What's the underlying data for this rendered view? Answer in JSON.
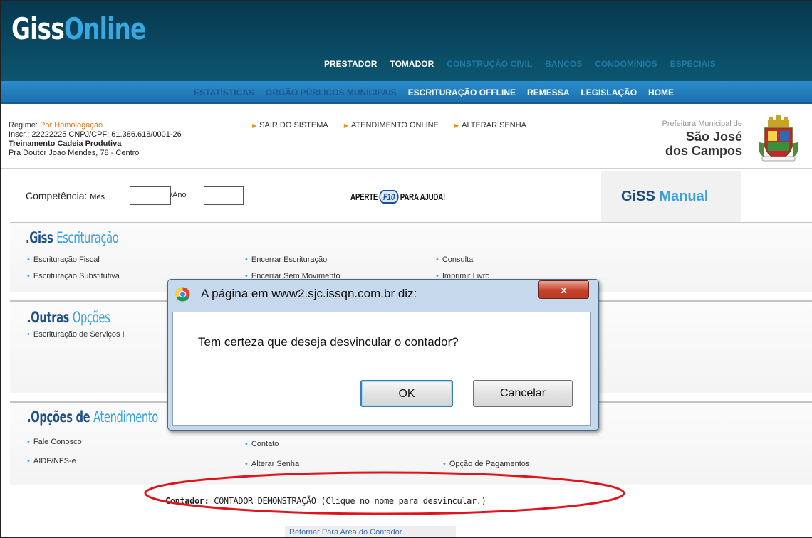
{
  "header": {
    "logo_part1": "Giss",
    "logo_part2": "Online",
    "nav_primary": [
      {
        "label": "PRESTADOR",
        "active": true
      },
      {
        "label": "TOMADOR",
        "active": true
      },
      {
        "label": "CONSTRUÇÃO CIVIL",
        "active": false
      },
      {
        "label": "BANCOS",
        "active": false
      },
      {
        "label": "CONDOMÍNIOS",
        "active": false
      },
      {
        "label": "ESPECIAIS",
        "active": false
      }
    ],
    "nav_secondary": [
      {
        "label": "ESTATÍSTICAS",
        "active": false
      },
      {
        "label": "ORGÃO PÚBLICOS MUNICIPAIS",
        "active": false
      },
      {
        "label": "ESCRITURAÇÃO OFFLINE",
        "active": true
      },
      {
        "label": "REMESSA",
        "active": true
      },
      {
        "label": "LEGISLAÇÃO",
        "active": true
      },
      {
        "label": "HOME",
        "active": true
      }
    ]
  },
  "info": {
    "regime_label": "Regime:",
    "regime_value": "Por Homologação",
    "inscr": "Inscr.: 22222225 CNPJ/CPF: 61.386.618/0001-26",
    "company": "Treinamento Cadeia Produtiva",
    "address": "Pra Doutor Joao Mendes, 78 - Centro",
    "links": [
      "SAIR DO SISTEMA",
      "ATENDIMENTO ONLINE",
      "ALTERAR SENHA"
    ],
    "prefeitura": "Prefeitura Municipal de",
    "city_line1": "São José",
    "city_line2": "dos Campos"
  },
  "competencia": {
    "label": "Competência:",
    "mes_label": "Mês",
    "mes_value": "",
    "ano_label": "/Ano",
    "ano_value": "",
    "aperte": "APERTE",
    "f10": "F10",
    "ajuda": "PARA AJUDA!",
    "manual_part1": "GiSS",
    "manual_part2": "Manual"
  },
  "sections": {
    "escrituracao": {
      "title_a": ".Giss",
      "title_b": "Escrituração",
      "items": [
        "Escrituração Fiscal",
        "Encerrar Escrituração",
        "Consulta",
        "Escrituração Substitutiva",
        "Encerrar Sem Movimento",
        "Imprimir Livro"
      ]
    },
    "outras": {
      "title_a": ".Outras",
      "title_b": "Opções",
      "items": [
        "Escrituração de Serviços I"
      ]
    },
    "atendimento": {
      "title_a": ".Opções de",
      "title_b": "Atendimento",
      "items": [
        "Fale Conosco",
        "Contato",
        "AIDF/NFS-e",
        "Alterar Senha",
        "Opção de Pagamentos"
      ]
    }
  },
  "contador": {
    "label": "Contador:",
    "value": "CONTADOR DEMONSTRAÇÃO (Clique no nome para desvincular.)"
  },
  "retomar": "Retornar Para Area do Contador",
  "dialog": {
    "title": "A página em www2.sjc.issqn.com.br diz:",
    "close": "x",
    "message": "Tem certeza que deseja desvincular o contador?",
    "ok": "OK",
    "cancel": "Cancelar"
  },
  "colors": {
    "header_dark": "#0a4a63",
    "nav_blue": "#1d6fae",
    "accent_orange": "#e4761a",
    "annotation_red": "#e0141c"
  }
}
